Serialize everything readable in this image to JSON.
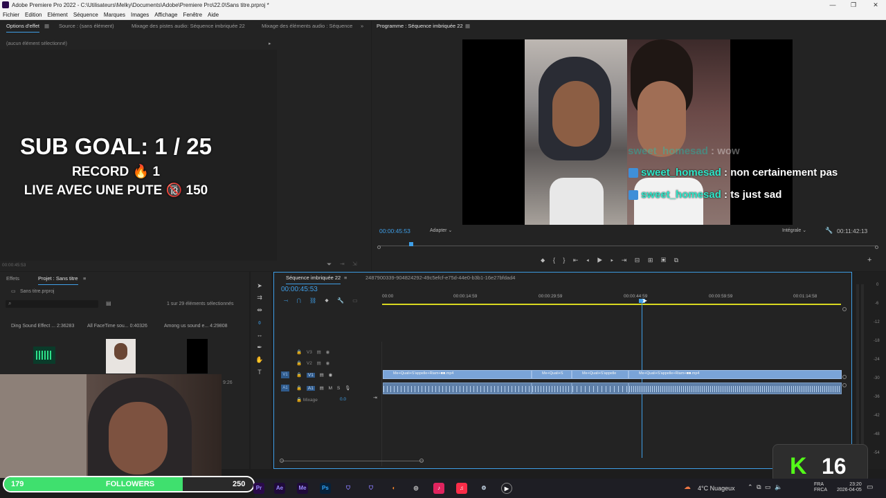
{
  "window": {
    "title": "Adobe Premiere Pro 2022 - C:\\Utilisateurs\\Melky\\Documents\\Adobe\\Premiere Pro\\22.0\\Sans titre.prproj *",
    "minimize": "—",
    "maximize": "❐",
    "close": "✕"
  },
  "menu": [
    "Fichier",
    "Edition",
    "Elément",
    "Séquence",
    "Marques",
    "Images",
    "Affichage",
    "Fenêtre",
    "Aide"
  ],
  "source_panel": {
    "tabs": [
      "Options d'effet",
      "Source : (sans élément)",
      "Mixage des pistes audio: Séquence imbriquée 22",
      "Mixage des éléments audio : Séquence"
    ],
    "no_selection": "(aucun élément sélectionné)",
    "timecode": "00:00:45:53"
  },
  "overlay": {
    "sub_goal": "SUB GOAL: 1 / 25",
    "record": "RECORD 🔥 1",
    "live": "LIVE AVEC UNE PUTE 🔞 150"
  },
  "program_monitor": {
    "tab": "Programme : Séquence imbriquée 22",
    "timecode": "00:00:45:53",
    "fit": "Adapter",
    "quality": "Intégrale",
    "duration": "00:11:42:13",
    "playhead_fraction": 0.065,
    "chat": [
      {
        "user": "sweet_homesad",
        "msg": " : wow"
      },
      {
        "user": "sweet_homesad",
        "msg": " : non certainement pas"
      },
      {
        "user": "sweet_homesad",
        "msg": " : ts just sad"
      }
    ]
  },
  "project_panel": {
    "tabs": [
      "Effets",
      "Projet : Sans titre"
    ],
    "file": "Sans titre.prproj",
    "count": "1 sur 29 éléments sélectionnés",
    "items": [
      {
        "name": "Ding Sound Effect ...",
        "dur": "2:36283"
      },
      {
        "name": "All FaceTime sou...",
        "dur": "0:40326"
      },
      {
        "name": "Among us sound e...",
        "dur": "4:29808"
      }
    ],
    "partial_dur": "9:26"
  },
  "timeline": {
    "tab": "Séquence imbriquée 22",
    "id_tab": "2487900339-904824292-49c5efcf-e75d-44e0-b3b1-16e27bfdad4",
    "timecode": "00:00:45:53",
    "ruler": [
      "00:00",
      "00:00:14:59",
      "00:00:29:59",
      "00:00:44:59",
      "00:00:59:59",
      "00:01:14:58"
    ],
    "tracks": {
      "v3": "V3",
      "v2": "V2",
      "v1_src": "V1",
      "v1": "V1",
      "a1_src": "A1",
      "a1": "A1",
      "m": "M",
      "s": "S",
      "mix_label": "Mixage",
      "mix_value": "0.0"
    },
    "clips": [
      {
        "label": "Me+Quali+S'appelle+Riam+■■.mp4"
      },
      {
        "label": "Me+Quali+S"
      },
      {
        "label": "Me+Quali+S'appelle"
      },
      {
        "label": "Me+Quali+S'appelle+Riam+■■.mp4"
      }
    ],
    "meter": [
      "0",
      "-6",
      "-12",
      "-18",
      "-24",
      "-30",
      "-36",
      "-42",
      "-48",
      "-54"
    ]
  },
  "stream": {
    "followers_current": "179",
    "followers_label": "FOLLOWERS",
    "followers_goal": "250",
    "followers_fraction": 0.716,
    "kick_count": "16",
    "kick_letter": "K"
  },
  "taskbar": {
    "weather": "4°C Nuageux",
    "lang1": "FRA",
    "lang2": "FRCA",
    "time": "23:20",
    "date": "2026-04-05",
    "apps": [
      "Pr",
      "Ae",
      "Me",
      "Ps"
    ]
  }
}
